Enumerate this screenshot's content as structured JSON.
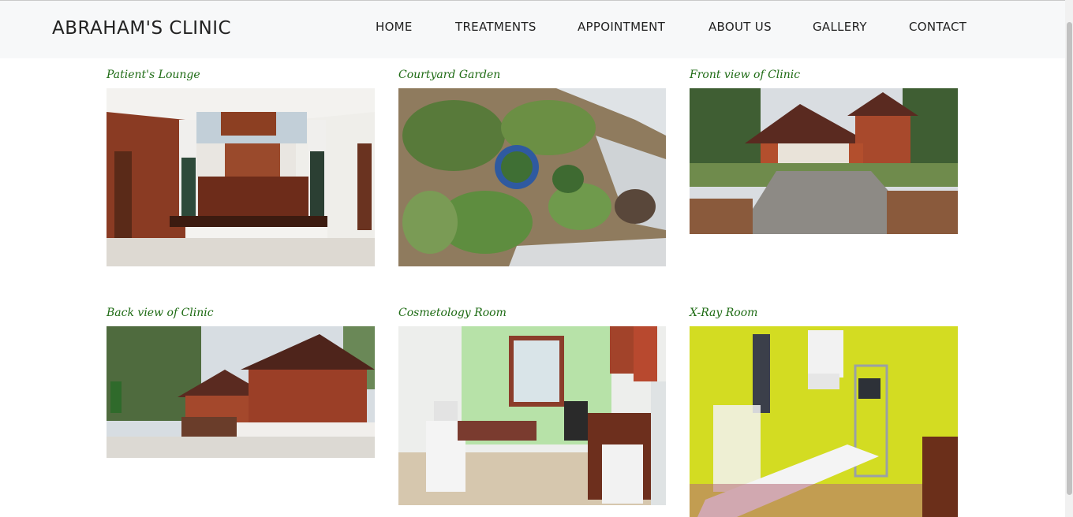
{
  "brand": "ABRAHAM'S CLINIC",
  "nav": {
    "home": "HOME",
    "treatments": "TREATMENTS",
    "appointment": "APPOINTMENT",
    "about": "ABOUT US",
    "gallery": "GALLERY",
    "contact": "CONTACT"
  },
  "gallery": [
    {
      "caption": "Patient's Lounge"
    },
    {
      "caption": "Courtyard Garden"
    },
    {
      "caption": "Front view of Clinic"
    },
    {
      "caption": "Back view of Clinic"
    },
    {
      "caption": "Cosmetology Room"
    },
    {
      "caption": "X-Ray Room"
    }
  ],
  "colors": {
    "caption": "#1e6b14",
    "navbar_bg": "#f7f8f9",
    "text": "#222222"
  }
}
